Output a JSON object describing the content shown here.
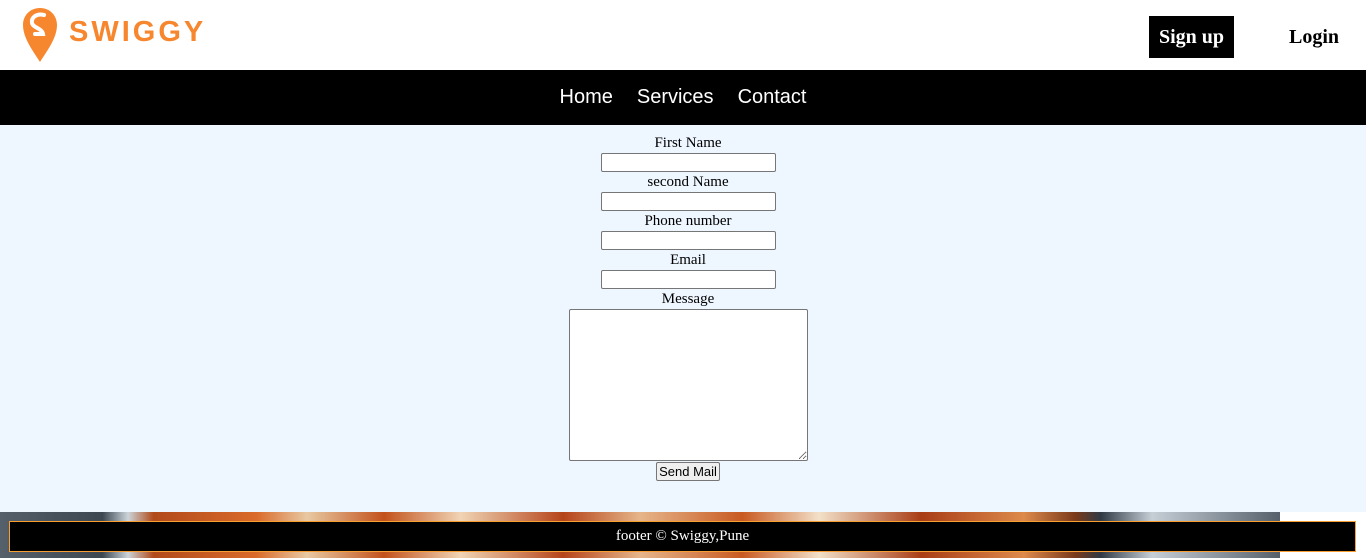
{
  "brand": {
    "name": "SWIGGY",
    "color": "#f7872e",
    "icon": "swiggy-logo-icon"
  },
  "header": {
    "signup_label": "Sign up",
    "login_label": "Login"
  },
  "nav": {
    "items": [
      {
        "label": "Home"
      },
      {
        "label": "Services"
      },
      {
        "label": "Contact"
      }
    ]
  },
  "form": {
    "first_name_label": "First Name",
    "first_name_value": "",
    "second_name_label": "second Name",
    "second_name_value": "",
    "phone_label": "Phone number",
    "phone_value": "",
    "email_label": "Email",
    "email_value": "",
    "message_label": "Message",
    "message_value": "",
    "submit_label": "Send Mail"
  },
  "footer": {
    "text": "footer © Swiggy,Pune"
  },
  "colors": {
    "nav_bg": "#000000",
    "form_bg": "#eef6ff",
    "footer_border": "#f7a030"
  }
}
